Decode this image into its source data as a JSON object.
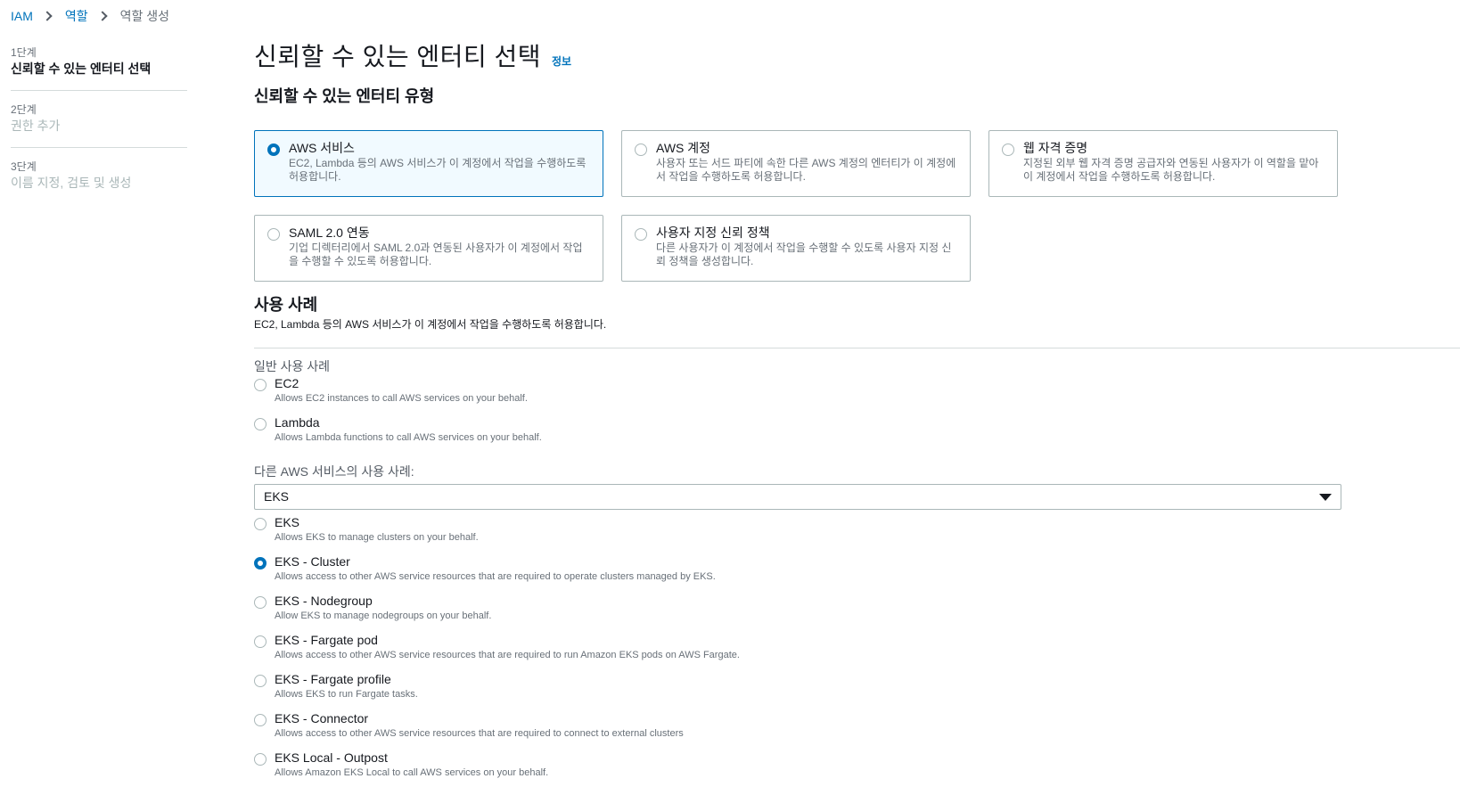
{
  "breadcrumb": {
    "items": [
      "IAM",
      "역할",
      "역할 생성"
    ]
  },
  "steps": [
    {
      "num": "1단계",
      "label": "신뢰할 수 있는 엔터티 선택"
    },
    {
      "num": "2단계",
      "label": "권한 추가"
    },
    {
      "num": "3단계",
      "label": "이름 지정, 검토 및 생성"
    }
  ],
  "page": {
    "title": "신뢰할 수 있는 엔터티 선택",
    "info": "정보",
    "entity_type_heading": "신뢰할 수 있는 엔터티 유형"
  },
  "tiles": [
    {
      "title": "AWS 서비스",
      "desc": "EC2, Lambda 등의 AWS 서비스가 이 계정에서 작업을 수행하도록 허용합니다.",
      "selected": true
    },
    {
      "title": "AWS 계정",
      "desc": "사용자 또는 서드 파티에 속한 다른 AWS 계정의 엔터티가 이 계정에서 작업을 수행하도록 허용합니다.",
      "selected": false
    },
    {
      "title": "웹 자격 증명",
      "desc": "지정된 외부 웹 자격 증명 공급자와 연동된 사용자가 이 역할을 맡아 이 계정에서 작업을 수행하도록 허용합니다.",
      "selected": false
    },
    {
      "title": "SAML 2.0 연동",
      "desc": "기업 디렉터리에서 SAML 2.0과 연동된 사용자가 이 계정에서 작업을 수행할 수 있도록 허용합니다.",
      "selected": false
    },
    {
      "title": "사용자 지정 신뢰 정책",
      "desc": "다른 사용자가 이 계정에서 작업을 수행할 수 있도록 사용자 지정 신뢰 정책을 생성합니다.",
      "selected": false
    }
  ],
  "usecase": {
    "title": "사용 사례",
    "desc": "EC2, Lambda 등의 AWS 서비스가 이 계정에서 작업을 수행하도록 허용합니다.",
    "common_label": "일반 사용 사례",
    "common": [
      {
        "label": "EC2",
        "desc": "Allows EC2 instances to call AWS services on your behalf."
      },
      {
        "label": "Lambda",
        "desc": "Allows Lambda functions to call AWS services on your behalf."
      }
    ],
    "other_label": "다른 AWS 서비스의 사용 사례:",
    "select_value": "EKS",
    "other": [
      {
        "label": "EKS",
        "desc": "Allows EKS to manage clusters on your behalf.",
        "selected": false
      },
      {
        "label": "EKS - Cluster",
        "desc": "Allows access to other AWS service resources that are required to operate clusters managed by EKS.",
        "selected": true
      },
      {
        "label": "EKS - Nodegroup",
        "desc": "Allow EKS to manage nodegroups on your behalf.",
        "selected": false
      },
      {
        "label": "EKS - Fargate pod",
        "desc": "Allows access to other AWS service resources that are required to run Amazon EKS pods on AWS Fargate.",
        "selected": false
      },
      {
        "label": "EKS - Fargate profile",
        "desc": "Allows EKS to run Fargate tasks.",
        "selected": false
      },
      {
        "label": "EKS - Connector",
        "desc": "Allows access to other AWS service resources that are required to connect to external clusters",
        "selected": false
      },
      {
        "label": "EKS Local - Outpost",
        "desc": "Allows Amazon EKS Local to call AWS services on your behalf.",
        "selected": false
      }
    ]
  },
  "colors": {
    "accent": "#0073bb",
    "selected_tile_bg": "#f1faff"
  }
}
